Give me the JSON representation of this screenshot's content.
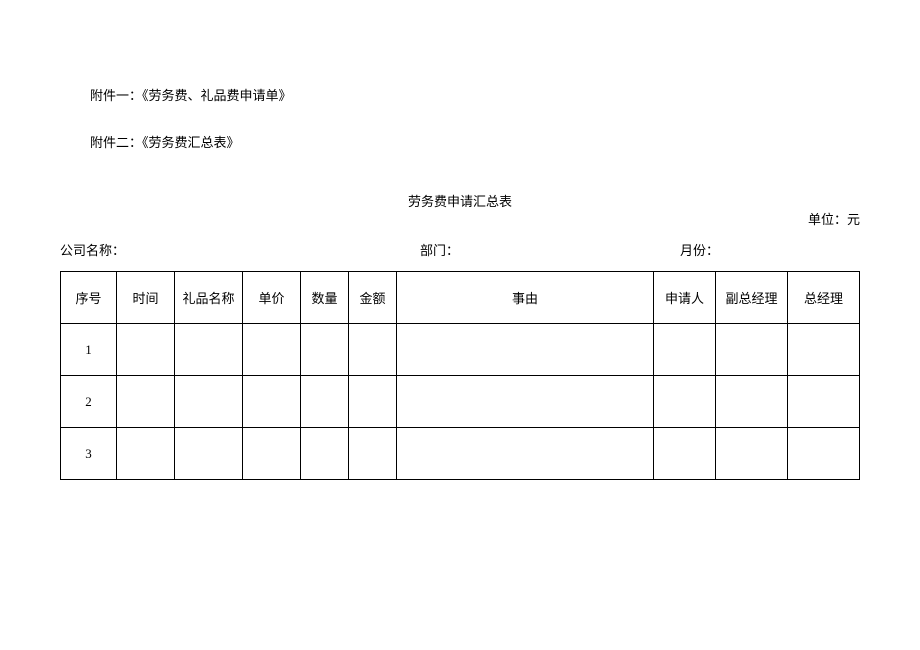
{
  "attachments": {
    "line1": "附件一：《劳务费、礼品费申请单》",
    "line2": "附件二：《劳务费汇总表》"
  },
  "title": "劳务费申请汇总表",
  "unit_label": "单位：元",
  "meta": {
    "company_label": "公司名称：",
    "company_value": "",
    "dept_label": "部门：",
    "dept_value": "",
    "month_label": "月份：",
    "month_value": ""
  },
  "table": {
    "headers": {
      "seq": "序号",
      "time": "时间",
      "gift_name": "礼品名称",
      "unit_price": "单价",
      "quantity": "数量",
      "amount": "金额",
      "reason": "事由",
      "applicant": "申请人",
      "deputy_gm": "副总经理",
      "gm": "总经理"
    },
    "rows": [
      {
        "seq": "1",
        "time": "",
        "gift_name": "",
        "unit_price": "",
        "quantity": "",
        "amount": "",
        "reason": "",
        "applicant": "",
        "deputy_gm": "",
        "gm": ""
      },
      {
        "seq": "2",
        "time": "",
        "gift_name": "",
        "unit_price": "",
        "quantity": "",
        "amount": "",
        "reason": "",
        "applicant": "",
        "deputy_gm": "",
        "gm": ""
      },
      {
        "seq": "3",
        "time": "",
        "gift_name": "",
        "unit_price": "",
        "quantity": "",
        "amount": "",
        "reason": "",
        "applicant": "",
        "deputy_gm": "",
        "gm": ""
      }
    ]
  }
}
